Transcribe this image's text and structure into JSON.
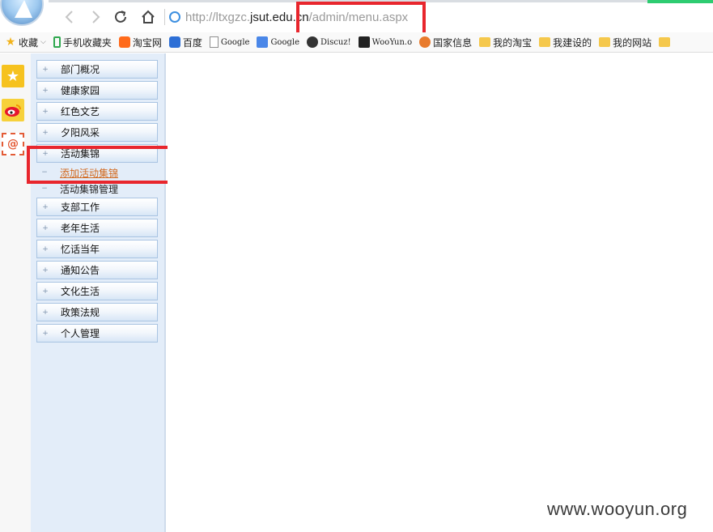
{
  "address_bar": {
    "url_prefix": "http://ltxgzc.",
    "url_domain": "jsut.edu.cn",
    "url_path": "/admin/menu.aspx"
  },
  "bookmarks": [
    {
      "label": "收藏",
      "icon": "star-icon"
    },
    {
      "label": "手机收藏夹",
      "icon": "phone-icon"
    },
    {
      "label": "淘宝网",
      "icon": "taobao-icon"
    },
    {
      "label": "百度",
      "icon": "baidu-paw-icon"
    },
    {
      "label": "Google",
      "icon": "page-icon"
    },
    {
      "label": "Google",
      "icon": "google-translate-icon"
    },
    {
      "label": "Discuz!",
      "icon": "discuz-icon"
    },
    {
      "label": "WooYun.o",
      "icon": "wooyun-icon"
    },
    {
      "label": "国家信息",
      "icon": "gov-icon"
    },
    {
      "label": "我的淘宝",
      "icon": "folder-icon"
    },
    {
      "label": "我建设的",
      "icon": "folder-icon"
    },
    {
      "label": "我的网站",
      "icon": "folder-icon"
    }
  ],
  "side_strip": {
    "mail_glyph": "@"
  },
  "menu": {
    "expand_glyph": "+",
    "collapse_glyph": "−",
    "items": [
      {
        "label": "部门概况"
      },
      {
        "label": "健康家园"
      },
      {
        "label": "红色文艺"
      },
      {
        "label": "夕阳风采"
      },
      {
        "label": "活动集锦"
      },
      {
        "label": "支部工作"
      },
      {
        "label": "老年生活"
      },
      {
        "label": "忆话当年"
      },
      {
        "label": "通知公告"
      },
      {
        "label": "文化生活"
      },
      {
        "label": "政策法规"
      },
      {
        "label": "个人管理"
      }
    ],
    "sub_items": [
      {
        "label": "添加活动集锦"
      },
      {
        "label": "活动集锦管理"
      }
    ]
  },
  "watermark": "www.wooyun.org",
  "colors": {
    "highlight_red": "#e8262d",
    "menu_bg": "#e3edf9",
    "link_orange": "#d2691e"
  }
}
